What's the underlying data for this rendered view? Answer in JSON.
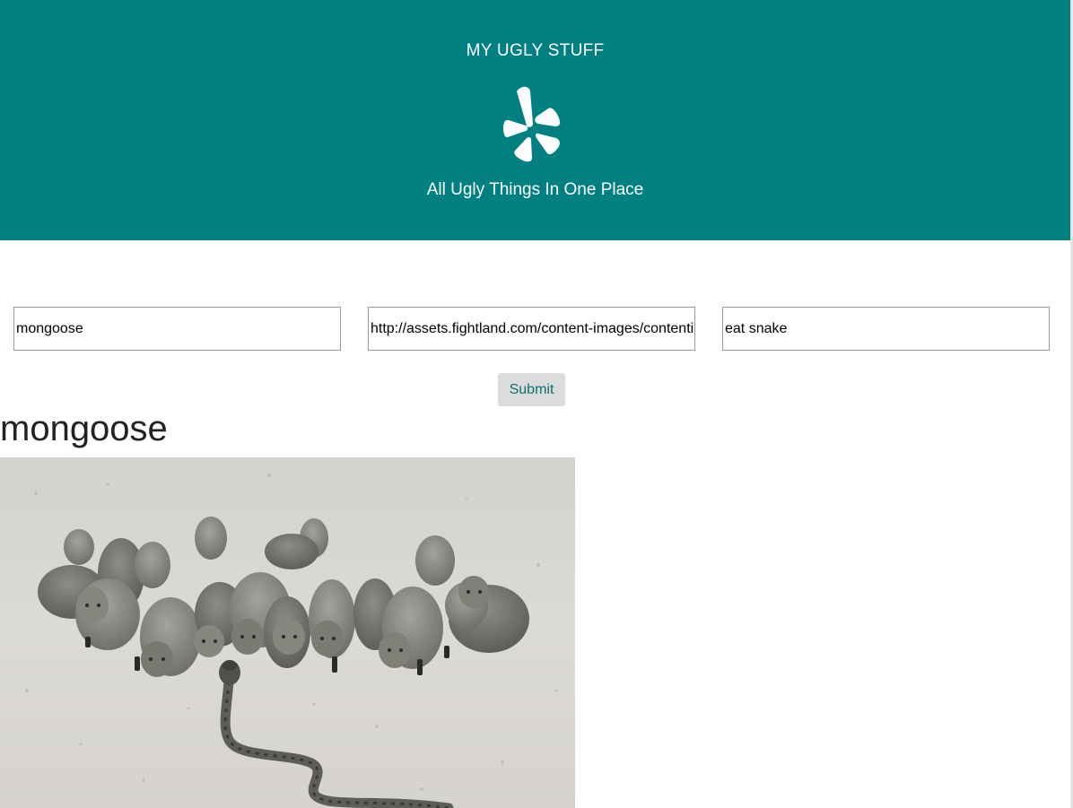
{
  "header": {
    "title": "MY UGLY STUFF",
    "tagline": "All Ugly Things In One Place",
    "logo_icon": "burst-logo-icon",
    "background_color": "#008080"
  },
  "form": {
    "fields": [
      {
        "value": "mongoose"
      },
      {
        "value": "http://assets.fightland.com/content-images/contentimage/mongoose.jpg"
      },
      {
        "value": "eat snake"
      }
    ],
    "submit_label": "Submit"
  },
  "items": [
    {
      "title": "mongoose",
      "image": "photo-of-mongoose-pack-facing-snake"
    }
  ]
}
